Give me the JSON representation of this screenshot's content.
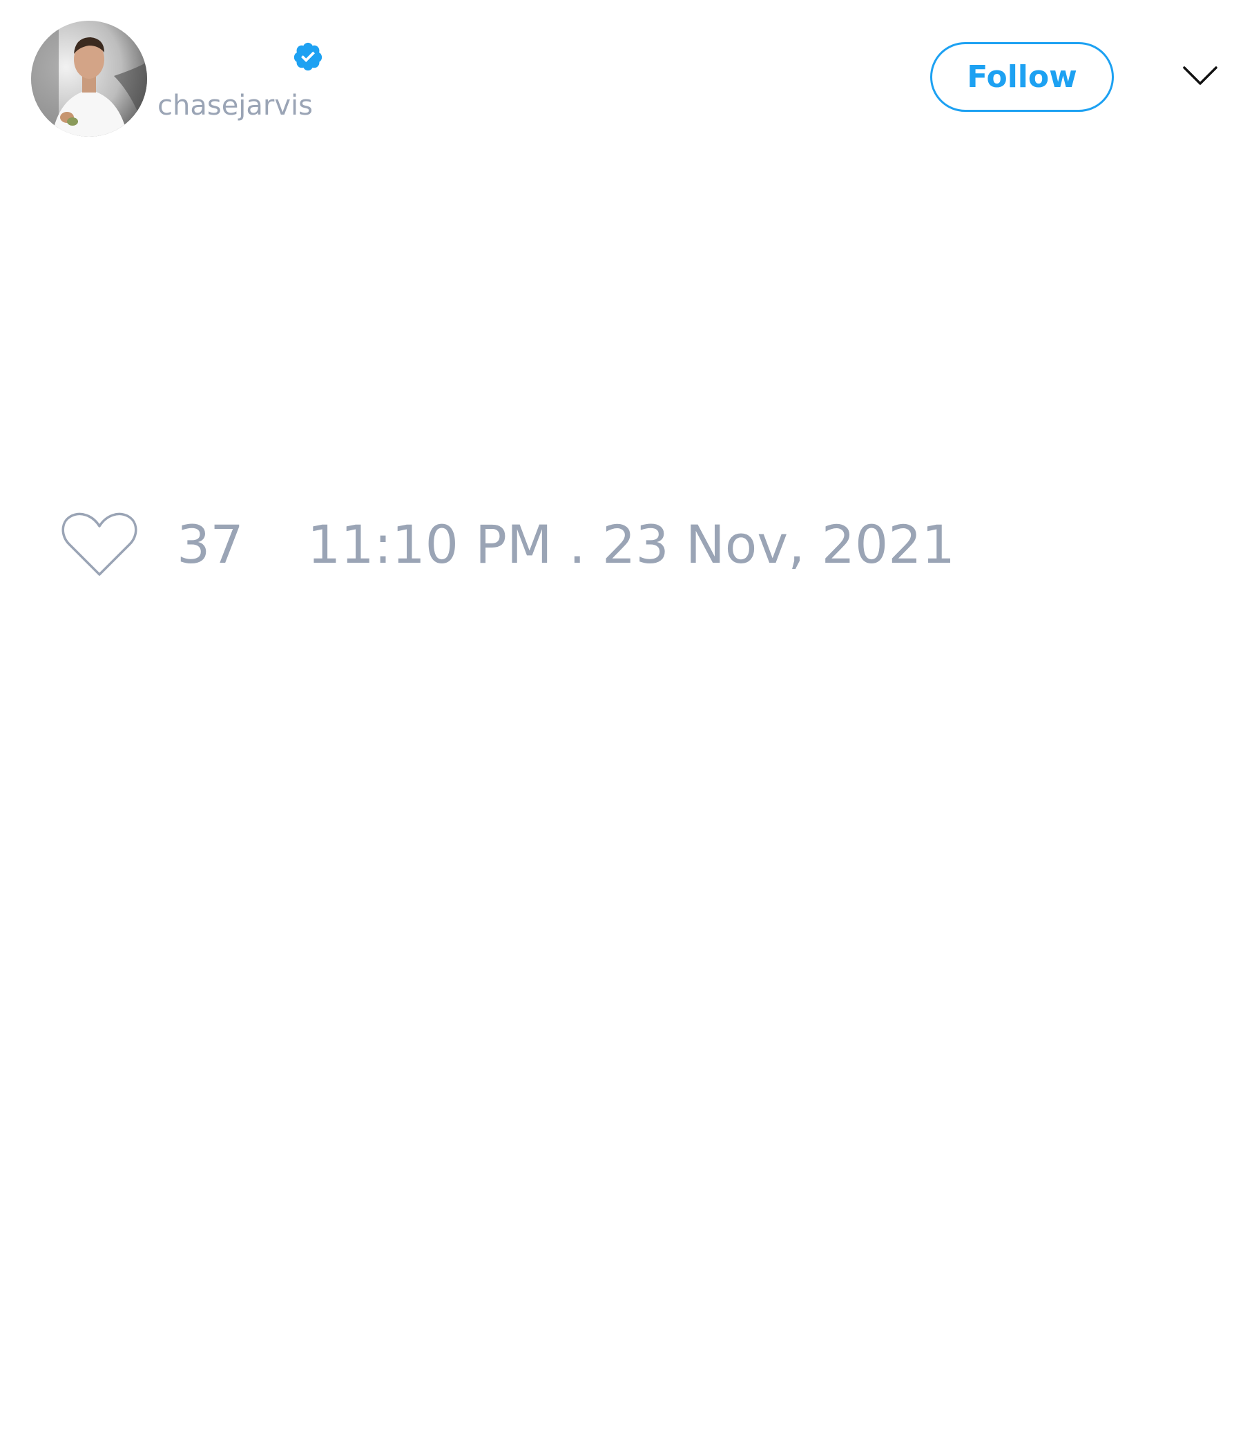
{
  "tweet": {
    "author": {
      "handle": "chasejarvis",
      "verified": true,
      "avatar_icon": "profile-photo"
    },
    "follow_label": "Follow",
    "menu_icon": "chevron-down-icon",
    "like_icon": "heart-outline-icon",
    "like_count": "37",
    "timestamp": "11:10 PM . 23 Nov, 2021"
  },
  "colors": {
    "accent": "#1da1f2",
    "muted_text": "#9aa4b5",
    "background": "#ffffff"
  }
}
